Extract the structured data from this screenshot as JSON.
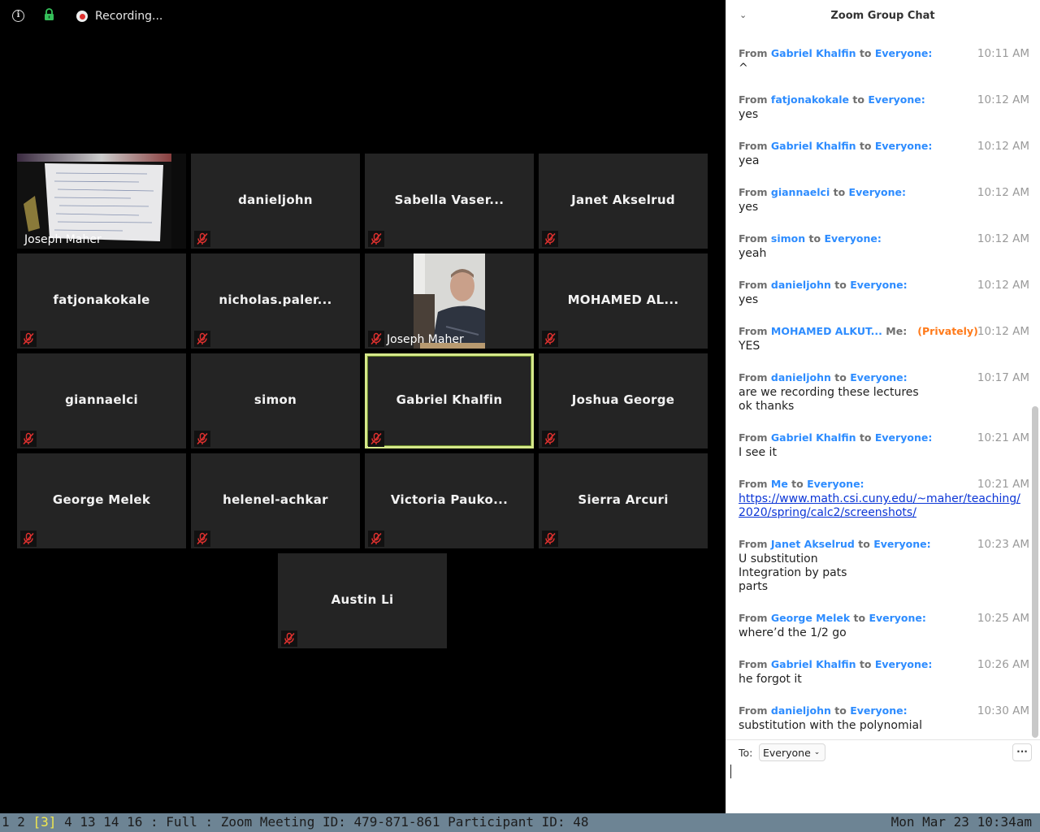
{
  "topbar": {
    "recording_label": "Recording..."
  },
  "participants": [
    {
      "name": "Joseph Maher",
      "type": "video-board"
    },
    {
      "name": "danieljohn",
      "type": "name"
    },
    {
      "name": "Sabella Vaser...",
      "type": "name"
    },
    {
      "name": "Janet Akselrud",
      "type": "name"
    },
    {
      "name": "fatjonakokale",
      "type": "name"
    },
    {
      "name": "nicholas.paler...",
      "type": "name"
    },
    {
      "name": "Joseph Maher",
      "type": "video-person"
    },
    {
      "name": "MOHAMED AL...",
      "type": "name"
    },
    {
      "name": "giannaelci",
      "type": "name"
    },
    {
      "name": "simon",
      "type": "name"
    },
    {
      "name": "Gabriel Khalfin",
      "type": "name",
      "active": true
    },
    {
      "name": "Joshua George",
      "type": "name"
    },
    {
      "name": "George Melek",
      "type": "name"
    },
    {
      "name": "helenel-achkar",
      "type": "name"
    },
    {
      "name": "Victoria Pauko...",
      "type": "name"
    },
    {
      "name": "Sierra Arcuri",
      "type": "name"
    },
    {
      "name": "Austin Li",
      "type": "name"
    }
  ],
  "chat": {
    "title": "Zoom Group Chat",
    "from_word": "From",
    "to_word": "to",
    "messages": [
      {
        "sender": "Gabriel Khalfin",
        "recipient": "Everyone:",
        "time": "10:11 AM",
        "lines": [
          "^"
        ]
      },
      {
        "sender": "fatjonakokale",
        "recipient": "Everyone:",
        "time": "10:12 AM",
        "lines": [
          "yes"
        ]
      },
      {
        "sender": "Gabriel Khalfin",
        "recipient": "Everyone:",
        "time": "10:12 AM",
        "lines": [
          "yea"
        ]
      },
      {
        "sender": "giannaelci",
        "recipient": "Everyone:",
        "time": "10:12 AM",
        "lines": [
          "yes"
        ]
      },
      {
        "sender": "simon",
        "recipient": "Everyone:",
        "time": "10:12 AM",
        "lines": [
          "yeah"
        ]
      },
      {
        "sender": "danieljohn",
        "recipient": "Everyone:",
        "time": "10:12 AM",
        "lines": [
          "yes"
        ]
      },
      {
        "sender": "MOHAMED ALKUT...",
        "recipient": "Me:",
        "private": "(Privately)",
        "time": "10:12 AM",
        "lines": [
          "YES"
        ]
      },
      {
        "sender": "danieljohn",
        "recipient": "Everyone:",
        "time": "10:17 AM",
        "lines": [
          "are we recording these lectures",
          "ok thanks"
        ]
      },
      {
        "sender": "Gabriel Khalfin",
        "recipient": "Everyone:",
        "time": "10:21 AM",
        "lines": [
          "I see it"
        ]
      },
      {
        "sender": "Me",
        "recipient": "Everyone:",
        "time": "10:21 AM",
        "link": [
          "https://www.math.csi.cuny.edu/~maher/teaching/",
          "2020/spring/calc2/screenshots/"
        ]
      },
      {
        "sender": "Janet Akselrud",
        "recipient": "Everyone:",
        "time": "10:23 AM",
        "lines": [
          "U substitution",
          "Integration by pats",
          "parts"
        ]
      },
      {
        "sender": "George Melek",
        "recipient": "Everyone:",
        "time": "10:25 AM",
        "lines": [
          "where’d the 1/2 go"
        ]
      },
      {
        "sender": "Gabriel Khalfin",
        "recipient": "Everyone:",
        "time": "10:26 AM",
        "lines": [
          "he forgot it"
        ]
      },
      {
        "sender": "danieljohn",
        "recipient": "Everyone:",
        "time": "10:30 AM",
        "lines": [
          "substitution with the polynomial"
        ]
      }
    ],
    "compose": {
      "to_label": "To:",
      "recipient": "Everyone",
      "more_label": "···"
    }
  },
  "statusbar": {
    "workspaces_before": "1 2 ",
    "workspace_active": "[3]",
    "workspaces_after": " 4 13 14 16 : Full : Zoom Meeting ID: 479-871-861 Participant ID: 48",
    "datetime": "Mon Mar 23 10:34am"
  },
  "colors": {
    "chat_name_blue": "#2d8cff",
    "private_orange": "#ff7a1a",
    "active_speaker_border": "#d6e88a",
    "tile_bg": "#242424",
    "statusbar_bg": "#6d8494"
  }
}
